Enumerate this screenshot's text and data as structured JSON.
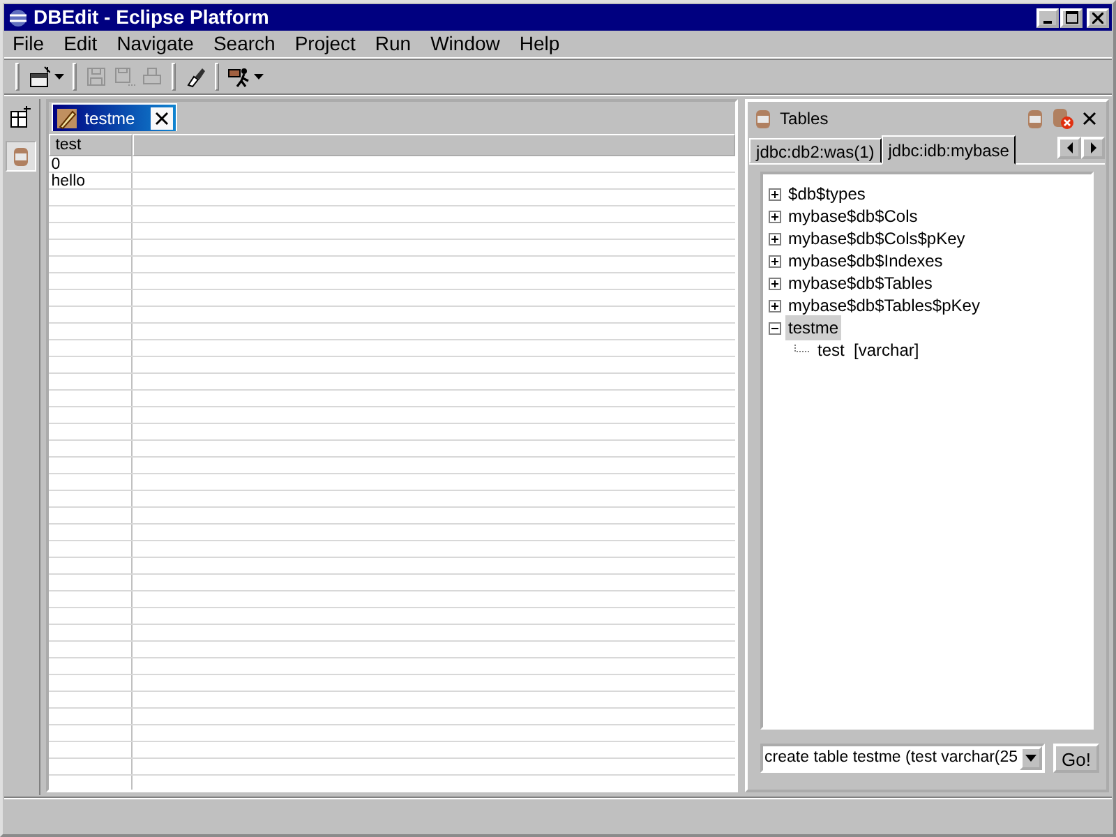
{
  "window": {
    "title": "DBEdit - Eclipse Platform"
  },
  "menu": [
    {
      "label": "File"
    },
    {
      "label": "Edit"
    },
    {
      "label": "Navigate"
    },
    {
      "label": "Search"
    },
    {
      "label": "Project"
    },
    {
      "label": "Run"
    },
    {
      "label": "Window"
    },
    {
      "label": "Help"
    }
  ],
  "toolbar": [
    {
      "kind": "new",
      "disabled": false,
      "dropdown": true
    },
    {
      "kind": "save",
      "disabled": true,
      "dropdown": false
    },
    {
      "kind": "save-all",
      "disabled": true,
      "dropdown": false
    },
    {
      "kind": "print",
      "disabled": true,
      "dropdown": false
    },
    {
      "kind": "brush",
      "disabled": false,
      "dropdown": false
    },
    {
      "kind": "run",
      "disabled": false,
      "dropdown": true
    }
  ],
  "shortcut_bar": [
    {
      "kind": "perspective",
      "selected": false
    },
    {
      "kind": "database",
      "selected": true
    }
  ],
  "editor": {
    "tab": {
      "label": "testme",
      "selected": true
    },
    "columns": [
      "test"
    ],
    "rows": [
      [
        "0"
      ],
      [
        "hello"
      ]
    ]
  },
  "tables_view": {
    "title": "Tables",
    "tabs": [
      {
        "label": "jdbc:db2:was(1)",
        "selected": false
      },
      {
        "label": "jdbc:idb:mybase",
        "selected": true
      }
    ],
    "tree": [
      {
        "label": "$db$types",
        "expanded": false,
        "selected": false
      },
      {
        "label": "mybase$db$Cols",
        "expanded": false,
        "selected": false
      },
      {
        "label": "mybase$db$Cols$pKey",
        "expanded": false,
        "selected": false
      },
      {
        "label": "mybase$db$Indexes",
        "expanded": false,
        "selected": false
      },
      {
        "label": "mybase$db$Tables",
        "expanded": false,
        "selected": false
      },
      {
        "label": "mybase$db$Tables$pKey",
        "expanded": false,
        "selected": false
      },
      {
        "label": "testme",
        "expanded": true,
        "selected": true,
        "children": [
          {
            "label": "test  [varchar]",
            "selected": false
          }
        ]
      }
    ],
    "query": {
      "value": "create table testme (test varchar(25"
    },
    "go_button": "Go!"
  }
}
